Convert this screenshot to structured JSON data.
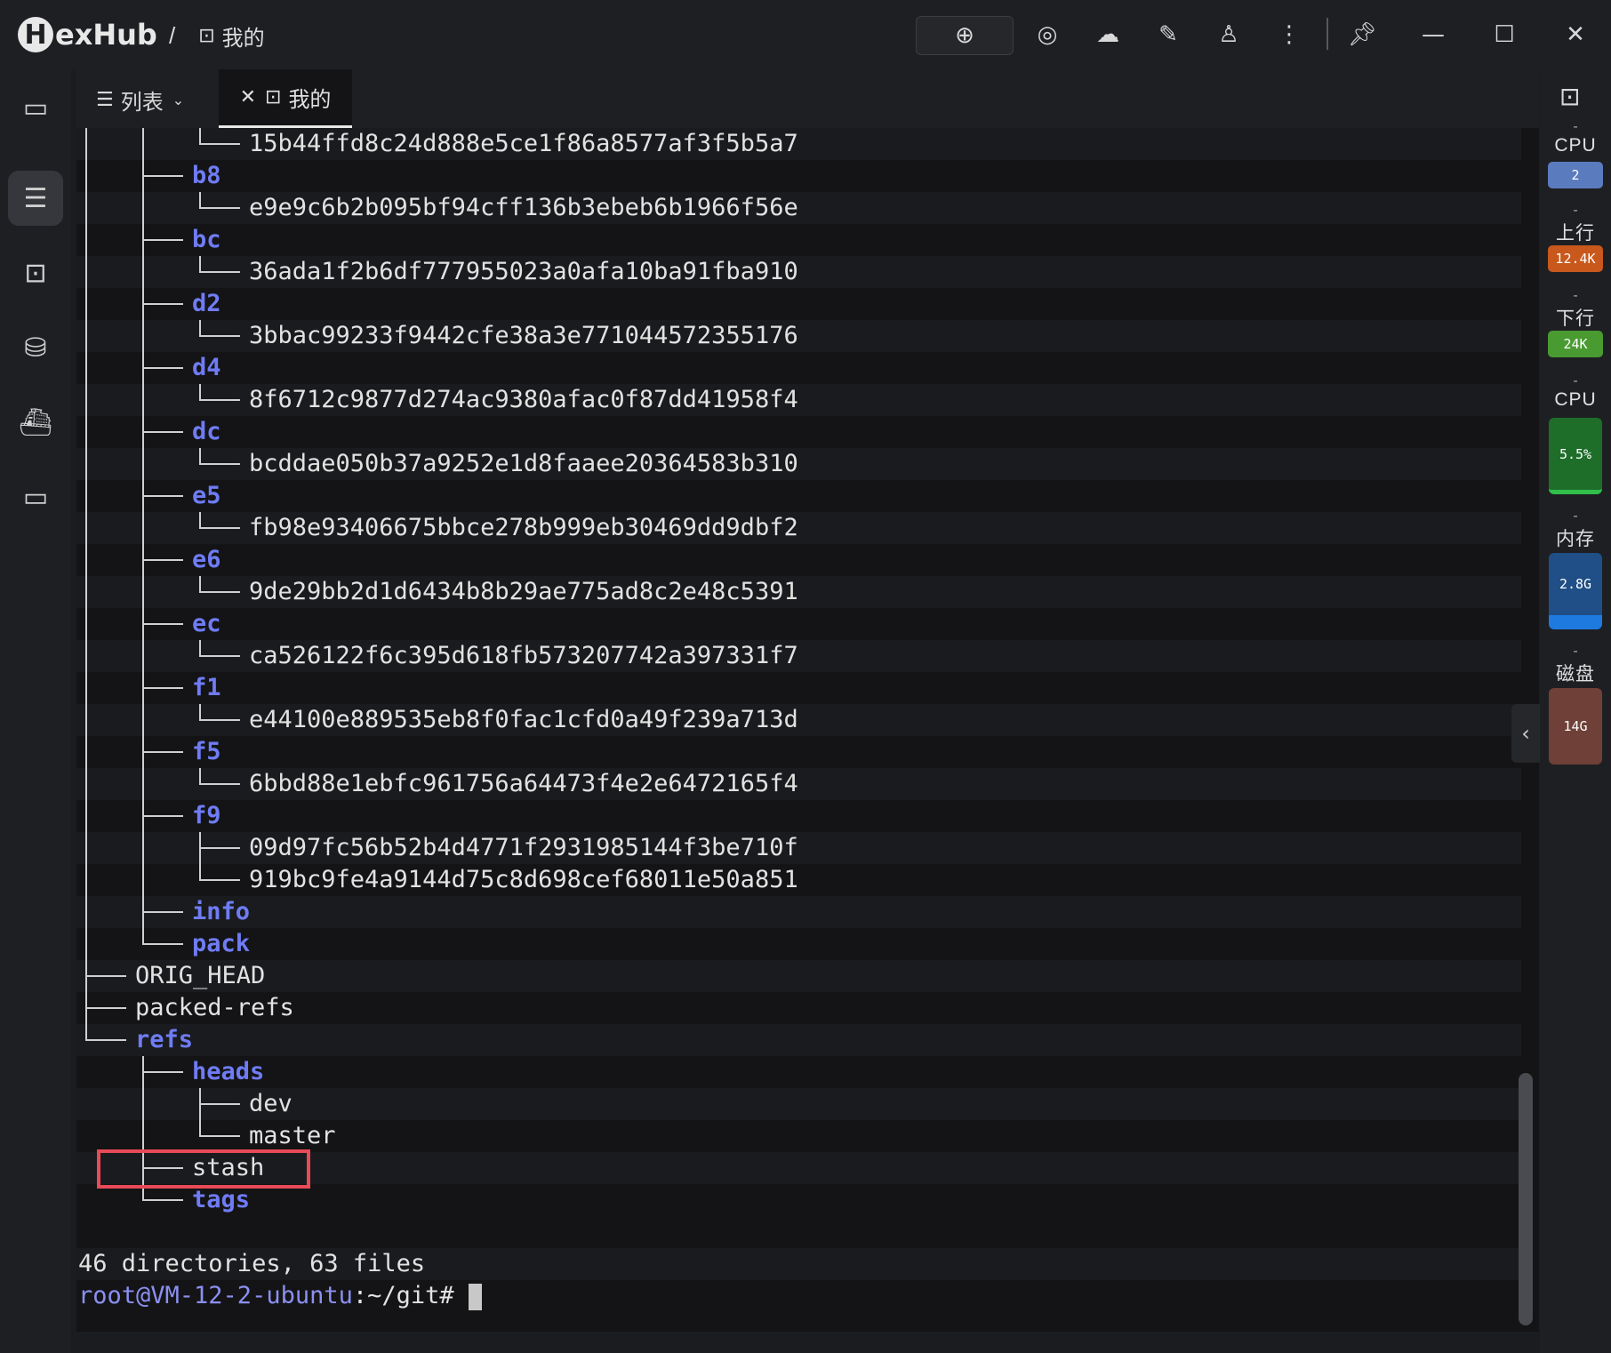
{
  "app": {
    "logo_letter": "H",
    "logo_rest": "exHub"
  },
  "breadcrumb": {
    "separator": "/",
    "current": "我的"
  },
  "tabs": {
    "list_label": "列表",
    "active_label": "我的"
  },
  "terminal": {
    "lines": [
      {
        "indent": 3,
        "text": "15b44ffd8c24d888e5ce1f86a8577af3f5b5a7",
        "kind": "file"
      },
      {
        "indent": 2,
        "text": "b8",
        "kind": "dir"
      },
      {
        "indent": 3,
        "text": "e9e9c6b2b095bf94cff136b3ebeb6b1966f56e",
        "kind": "file"
      },
      {
        "indent": 2,
        "text": "bc",
        "kind": "dir"
      },
      {
        "indent": 3,
        "text": "36ada1f2b6df777955023a0afa10ba91fba910",
        "kind": "file"
      },
      {
        "indent": 2,
        "text": "d2",
        "kind": "dir"
      },
      {
        "indent": 3,
        "text": "3bbac99233f9442cfe38a3e771044572355176",
        "kind": "file"
      },
      {
        "indent": 2,
        "text": "d4",
        "kind": "dir"
      },
      {
        "indent": 3,
        "text": "8f6712c9877d274ac9380afac0f87dd41958f4",
        "kind": "file"
      },
      {
        "indent": 2,
        "text": "dc",
        "kind": "dir"
      },
      {
        "indent": 3,
        "text": "bcddae050b37a9252e1d8faaee20364583b310",
        "kind": "file"
      },
      {
        "indent": 2,
        "text": "e5",
        "kind": "dir"
      },
      {
        "indent": 3,
        "text": "fb98e93406675bbce278b999eb30469dd9dbf2",
        "kind": "file"
      },
      {
        "indent": 2,
        "text": "e6",
        "kind": "dir"
      },
      {
        "indent": 3,
        "text": "9de29bb2d1d6434b8b29ae775ad8c2e48c5391",
        "kind": "file"
      },
      {
        "indent": 2,
        "text": "ec",
        "kind": "dir"
      },
      {
        "indent": 3,
        "text": "ca526122f6c395d618fb573207742a397331f7",
        "kind": "file"
      },
      {
        "indent": 2,
        "text": "f1",
        "kind": "dir"
      },
      {
        "indent": 3,
        "text": "e44100e889535eb8f0fac1cfd0a49f239a713d",
        "kind": "file"
      },
      {
        "indent": 2,
        "text": "f5",
        "kind": "dir"
      },
      {
        "indent": 3,
        "text": "6bbd88e1ebfc961756a64473f4e2e6472165f4",
        "kind": "file"
      },
      {
        "indent": 2,
        "text": "f9",
        "kind": "dir"
      },
      {
        "indent": 3,
        "text": "09d97fc56b52b4d4771f2931985144f3be710f",
        "kind": "file"
      },
      {
        "indent": 3,
        "text": "919bc9fe4a9144d75c8d698cef68011e50a851",
        "kind": "file"
      },
      {
        "indent": 2,
        "text": "info",
        "kind": "dir"
      },
      {
        "indent": 2,
        "text": "pack",
        "kind": "dir"
      },
      {
        "indent": 1,
        "text": "ORIG_HEAD",
        "kind": "file"
      },
      {
        "indent": 1,
        "text": "packed-refs",
        "kind": "file"
      },
      {
        "indent": 1,
        "text": "refs",
        "kind": "dir"
      },
      {
        "indent": 2,
        "text": "heads",
        "kind": "dir"
      },
      {
        "indent": 3,
        "text": "dev",
        "kind": "file"
      },
      {
        "indent": 3,
        "text": "master",
        "kind": "file"
      },
      {
        "indent": 2,
        "text": "stash",
        "kind": "file"
      },
      {
        "indent": 2,
        "text": "tags",
        "kind": "dir"
      }
    ],
    "summary": "46 directories, 63 files",
    "prompt_user": "root@VM-12-2-ubuntu",
    "prompt_path": ":~/git#"
  },
  "metrics": {
    "cpu_cores": {
      "label": "CPU",
      "value": "2",
      "color": "#5b7bbf"
    },
    "upload": {
      "label": "上行",
      "value": "12.4K",
      "color": "#c8581c"
    },
    "download": {
      "label": "下行",
      "value": "24K",
      "color": "#4a9a32"
    },
    "cpu_usage": {
      "label": "CPU",
      "value": "5.5%",
      "color": "#1e6e2a"
    },
    "memory": {
      "label": "内存",
      "value": "2.8G",
      "color": "#1f4f86"
    },
    "disk": {
      "label": "磁盘",
      "value": "14G",
      "color": "#6e4038"
    },
    "dash": "-"
  },
  "icons": {
    "titlebar": [
      "download-icon",
      "broadcast-icon",
      "cloud-sync-icon",
      "tools-icon",
      "user-icon",
      "more-icon",
      "pin-icon",
      "minimize-icon",
      "maximize-icon",
      "close-icon"
    ],
    "leftbar": [
      "folder-icon",
      "list-icon",
      "terminal-icon",
      "database-icon",
      "docker-icon",
      "chat-icon"
    ]
  }
}
